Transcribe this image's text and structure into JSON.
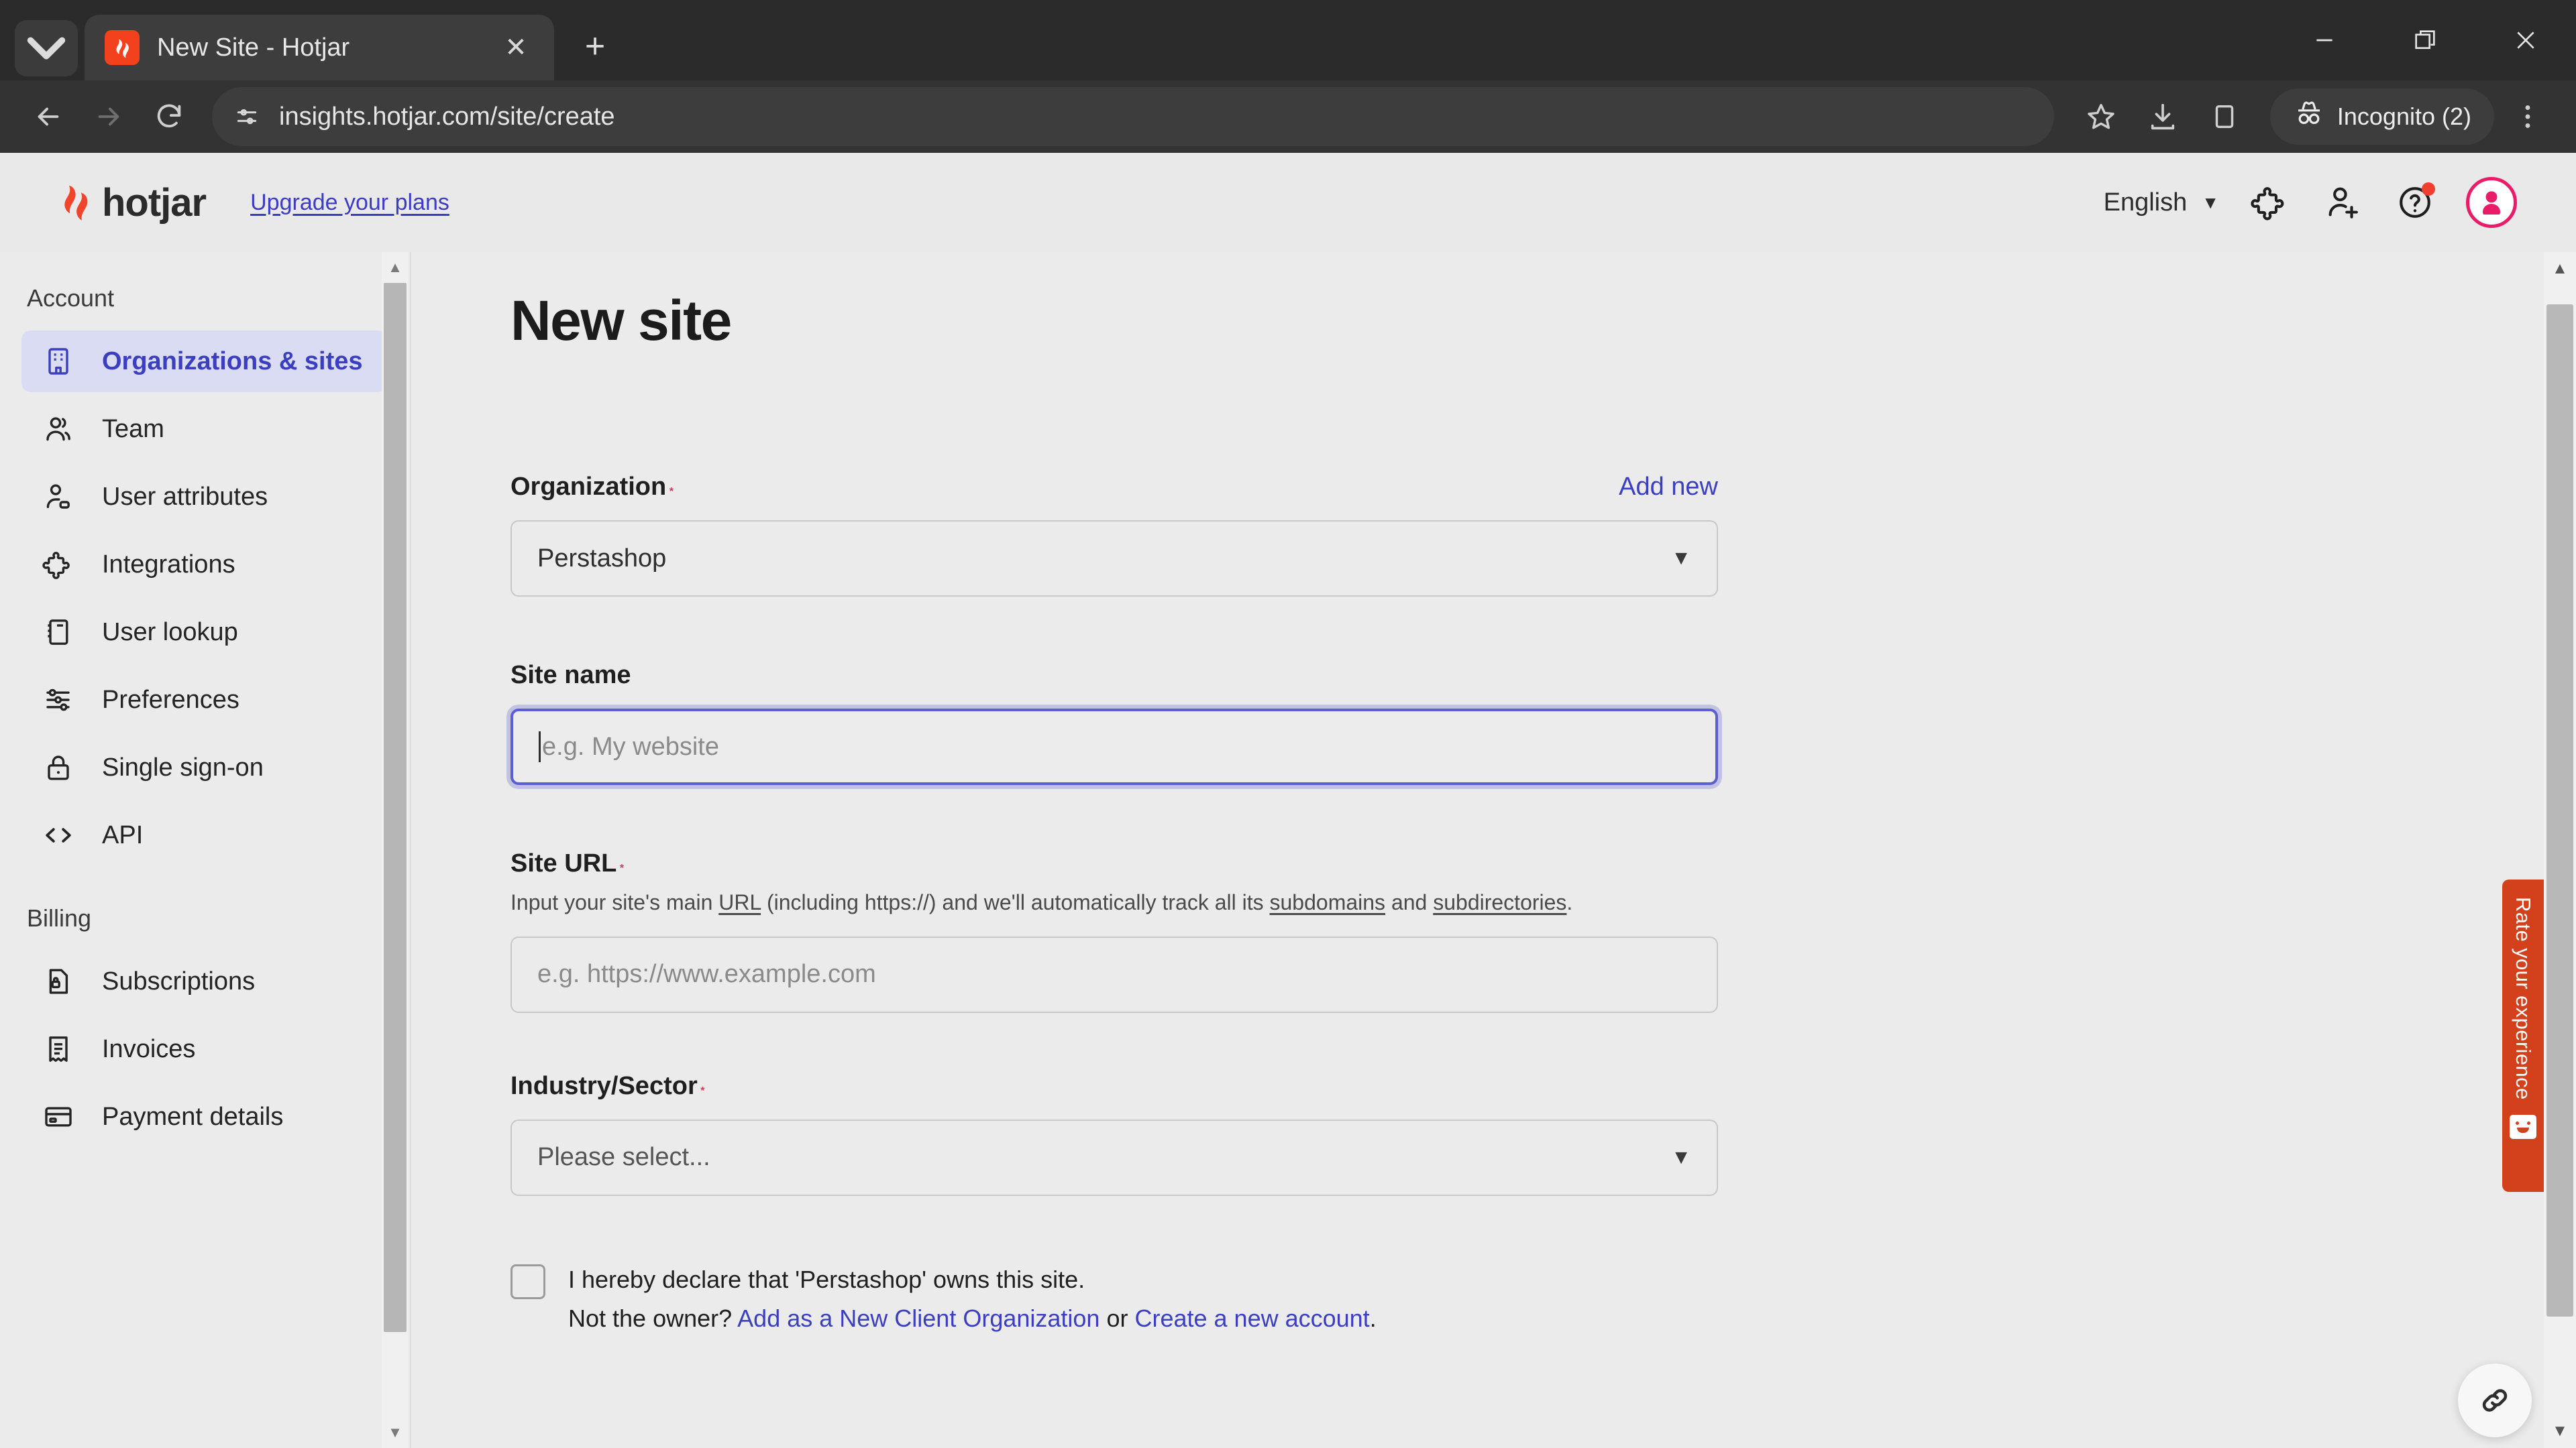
{
  "browser": {
    "tab": {
      "title": "New Site - Hotjar",
      "favicon_icon": "hotjar-favicon",
      "close_icon": "close-icon"
    },
    "tab_search_icon": "tab-search-chevron-icon",
    "new_tab_icon": "new-tab-plus-icon",
    "window_controls": {
      "minimize_icon": "minimize-icon",
      "maximize_icon": "maximize-restore-icon",
      "close_icon": "window-close-icon"
    },
    "nav": {
      "back_icon": "back-arrow-icon",
      "forward_icon": "forward-arrow-icon",
      "reload_icon": "reload-icon"
    },
    "omnibox": {
      "site_info_icon": "site-settings-icon",
      "url": "insights.hotjar.com/site/create"
    },
    "actions": {
      "bookmark_icon": "star-icon",
      "downloads_icon": "download-icon",
      "side_panel_icon": "side-panel-icon",
      "menu_icon": "three-dot-menu-icon",
      "incognito_label": "Incognito (2)",
      "incognito_icon": "incognito-hat-icon"
    }
  },
  "app_header": {
    "logo_mark_icon": "hotjar-flame-icon",
    "wordmark": "hotjar",
    "upgrade_link": "Upgrade your plans",
    "language": "English",
    "language_caret_icon": "chevron-down-icon",
    "integrations_icon": "puzzle-piece-icon",
    "invite_icon": "add-user-icon",
    "help_icon": "help-question-icon",
    "avatar_icon": "user-avatar-icon",
    "accent_color": "#ea1b68"
  },
  "sidebar": {
    "sections": [
      {
        "title": "Account",
        "items": [
          {
            "label": "Organizations & sites",
            "icon": "building-icon",
            "active": true
          },
          {
            "label": "Team",
            "icon": "people-icon",
            "active": false
          },
          {
            "label": "User attributes",
            "icon": "user-tag-icon",
            "active": false
          },
          {
            "label": "Integrations",
            "icon": "puzzle-piece-icon",
            "active": false
          },
          {
            "label": "User lookup",
            "icon": "notebook-icon",
            "active": false
          },
          {
            "label": "Preferences",
            "icon": "sliders-icon",
            "active": false
          },
          {
            "label": "Single sign-on",
            "icon": "lock-icon",
            "active": false
          },
          {
            "label": "API",
            "icon": "code-brackets-icon",
            "active": false
          }
        ]
      },
      {
        "title": "Billing",
        "items": [
          {
            "label": "Subscriptions",
            "icon": "document-lock-icon",
            "active": false
          },
          {
            "label": "Invoices",
            "icon": "receipt-icon",
            "active": false
          },
          {
            "label": "Payment details",
            "icon": "credit-card-icon",
            "active": false
          }
        ]
      }
    ],
    "active_bg_color": "#d9dcf3",
    "active_text_color": "#3b3fbf"
  },
  "main": {
    "page_title": "New site",
    "fields": {
      "organization": {
        "label": "Organization",
        "required_marker": "*",
        "add_new_link": "Add new",
        "selected_value": "Perstashop",
        "caret_icon": "dropdown-caret-icon"
      },
      "site_name": {
        "label": "Site name",
        "placeholder": "e.g. My website",
        "value": "",
        "focused": true
      },
      "site_url": {
        "label": "Site URL",
        "required_marker": "*",
        "helper_prefix": "Input your site's main ",
        "helper_url_word": "URL",
        "helper_mid": " (including https://) and we'll automatically track all its ",
        "helper_subdomains": "subdomains",
        "helper_and": " and ",
        "helper_subdirectories": "subdirectories",
        "helper_end": ".",
        "placeholder": "e.g. https://www.example.com",
        "value": ""
      },
      "industry_sector": {
        "label": "Industry/Sector",
        "required_marker": "*",
        "selected_value": "Please select...",
        "caret_icon": "dropdown-caret-icon"
      },
      "ownership": {
        "checkbox_checked": false,
        "declaration": "I hereby declare that 'Perstashop' owns this site.",
        "not_owner_prefix": "Not the owner? ",
        "link_client_org": "Add as a New Client Organization",
        "or_text": " or ",
        "link_new_account": "Create a new account",
        "period": "."
      }
    }
  },
  "widgets": {
    "rate_tab": {
      "label": "Rate your experience",
      "icon": "smiley-face-icon",
      "color": "#d3401c"
    },
    "float_link_button": {
      "icon": "link-chain-icon"
    }
  },
  "scrollbars": {
    "sidebar": {
      "up_icon": "scroll-up-arrow-icon",
      "down_icon": "scroll-down-arrow-icon"
    },
    "page": {
      "up_icon": "scroll-up-arrow-icon",
      "down_icon": "scroll-down-arrow-icon"
    }
  }
}
